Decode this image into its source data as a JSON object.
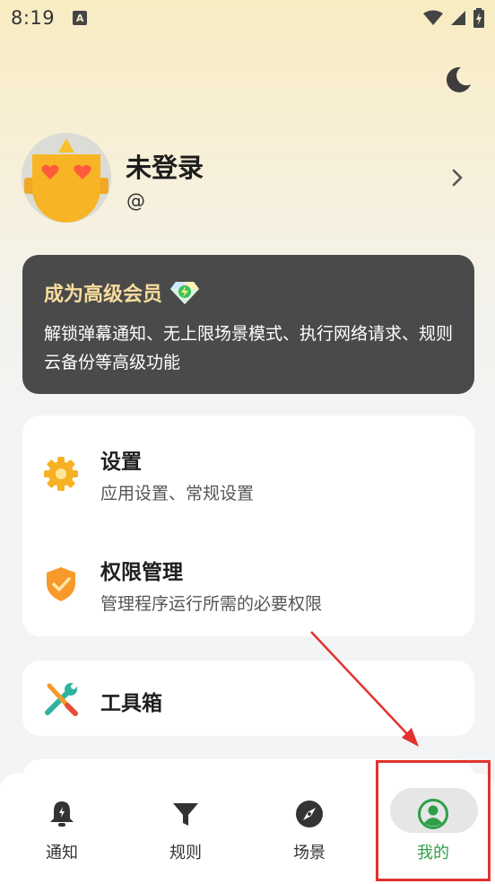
{
  "status_bar": {
    "time": "8:19",
    "notification_icon_letter": "A"
  },
  "theme_toggle": {
    "icon": "moon-icon"
  },
  "profile": {
    "name": "未登录",
    "handle": "@"
  },
  "vip": {
    "title": "成为高级会员",
    "description": "解锁弹幕通知、无上限场景模式、执行网络请求、规则云备份等高级功能"
  },
  "menu": {
    "settings": {
      "title": "设置",
      "subtitle": "应用设置、常规设置",
      "icon": "gear-icon"
    },
    "permissions": {
      "title": "权限管理",
      "subtitle": "管理程序运行所需的必要权限",
      "icon": "shield-check-icon"
    },
    "toolbox": {
      "title": "工具箱",
      "icon": "wrench-screwdriver-icon"
    }
  },
  "bottom_nav": {
    "items": [
      {
        "label": "通知",
        "icon": "bell-icon"
      },
      {
        "label": "规则",
        "icon": "filter-icon"
      },
      {
        "label": "场景",
        "icon": "compass-icon"
      },
      {
        "label": "我的",
        "icon": "user-circle-icon",
        "active": true
      }
    ]
  },
  "colors": {
    "accent_green": "#2e9f48",
    "vip_gold": "#f7dc9d",
    "annotation_red": "#e2322d"
  }
}
